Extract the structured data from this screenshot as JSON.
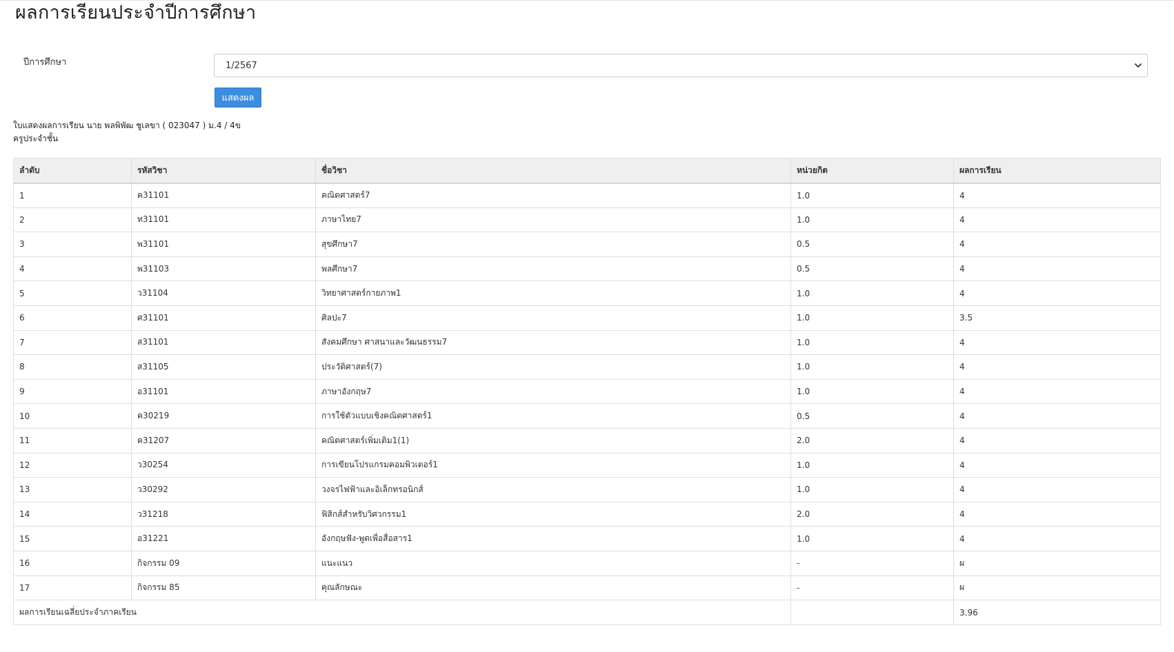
{
  "page": {
    "title": "ผลการเรียนประจำปีการศึกษา"
  },
  "form": {
    "year_label": "ปีการศึกษา",
    "year_selected": "1/2567",
    "submit_label": "แสดงผล"
  },
  "report": {
    "student_line": "ใบแสดงผลการเรียน นาย พลพิพัฒ ชูเลขา ( 023047 ) ม.4 / 4ข",
    "teacher_line": "ครูประจำชั้น"
  },
  "table": {
    "headers": {
      "order": "ลำดับ",
      "code": "รหัสวิชา",
      "name": "ชื่อวิชา",
      "credit": "หน่วยกิต",
      "grade": "ผลการเรียน"
    },
    "rows": [
      {
        "order": "1",
        "code": "ค31101",
        "name": "คณิตศาสตร์7",
        "credit": "1.0",
        "grade": "4"
      },
      {
        "order": "2",
        "code": "ท31101",
        "name": "ภาษาไทย7",
        "credit": "1.0",
        "grade": "4"
      },
      {
        "order": "3",
        "code": "พ31101",
        "name": "สุขศึกษา7",
        "credit": "0.5",
        "grade": "4"
      },
      {
        "order": "4",
        "code": "พ31103",
        "name": "พลศึกษา7",
        "credit": "0.5",
        "grade": "4"
      },
      {
        "order": "5",
        "code": "ว31104",
        "name": "วิทยาศาสตร์กายภาพ1",
        "credit": "1.0",
        "grade": "4"
      },
      {
        "order": "6",
        "code": "ศ31101",
        "name": "ศิลปะ7",
        "credit": "1.0",
        "grade": "3.5"
      },
      {
        "order": "7",
        "code": "ส31101",
        "name": "สังคมศึกษา ศาสนาและวัฒนธรรม7",
        "credit": "1.0",
        "grade": "4"
      },
      {
        "order": "8",
        "code": "ส31105",
        "name": "ประวัติศาสตร์(7)",
        "credit": "1.0",
        "grade": "4"
      },
      {
        "order": "9",
        "code": "อ31101",
        "name": "ภาษาอังกฤษ7",
        "credit": "1.0",
        "grade": "4"
      },
      {
        "order": "10",
        "code": "ค30219",
        "name": "การใช้ตัวแบบเชิงคณิตศาสตร์1",
        "credit": "0.5",
        "grade": "4"
      },
      {
        "order": "11",
        "code": "ค31207",
        "name": "คณิตศาสตร์เพิ่มเติม1(1)",
        "credit": "2.0",
        "grade": "4"
      },
      {
        "order": "12",
        "code": "ว30254",
        "name": "การเขียนโปรแกรมคอมพิวเตอร์1",
        "credit": "1.0",
        "grade": "4"
      },
      {
        "order": "13",
        "code": "ว30292",
        "name": "วงจรไฟฟ้าและอิเล็กทรอนิกส์",
        "credit": "1.0",
        "grade": "4"
      },
      {
        "order": "14",
        "code": "ว31218",
        "name": "ฟิสิกส์สำหรับวิศวกรรม1",
        "credit": "2.0",
        "grade": "4"
      },
      {
        "order": "15",
        "code": "อ31221",
        "name": "อังกฤษฟัง-พูดเพื่อสื่อสาร1",
        "credit": "1.0",
        "grade": "4"
      },
      {
        "order": "16",
        "code": "กิจกรรม 09",
        "name": "แนะแนว",
        "credit": "-",
        "grade": "ผ"
      },
      {
        "order": "17",
        "code": "กิจกรรม 85",
        "name": "คุณลักษณะ",
        "credit": "-",
        "grade": "ผ"
      }
    ],
    "footer": {
      "label": "ผลการเรียนเฉลี่ยประจำภาคเรียน",
      "gpa": "3.96"
    }
  },
  "colors": {
    "button": "#3c8dde",
    "header_bg": "#efefef",
    "border": "#dddddd"
  },
  "icons": {
    "select_arrow": "chevron-down-icon"
  }
}
